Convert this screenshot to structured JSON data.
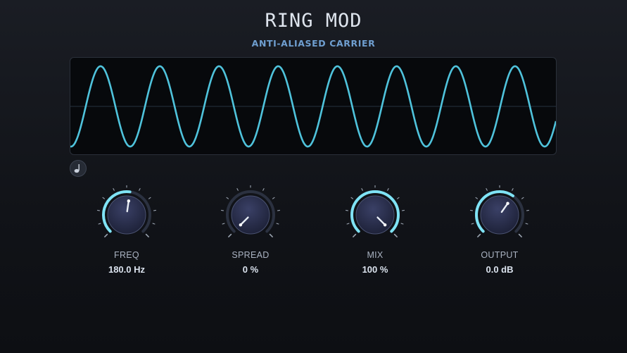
{
  "header": {
    "title": "RING MOD",
    "subtitle": "ANTI-ALIASED CARRIER"
  },
  "scope": {
    "cycles_shown": 8.2,
    "wave_color": "#4fc3dc",
    "background": "#07090c",
    "centerline_color": "#243240"
  },
  "sync_button": {
    "icon": "note-icon"
  },
  "knobs": [
    {
      "id": "freq",
      "label": "FREQ",
      "value": "180.0 Hz",
      "level": 0.53
    },
    {
      "id": "spread",
      "label": "SPREAD",
      "value": "0 %",
      "level": 0.0
    },
    {
      "id": "mix",
      "label": "MIX",
      "value": "100 %",
      "level": 1.0
    },
    {
      "id": "output",
      "label": "OUTPUT",
      "value": "0.0 dB",
      "level": 0.63
    }
  ],
  "colors": {
    "accent": "#7fe3f5",
    "knob_body": "#2a2f4a",
    "tick": "#9aa3b0"
  }
}
